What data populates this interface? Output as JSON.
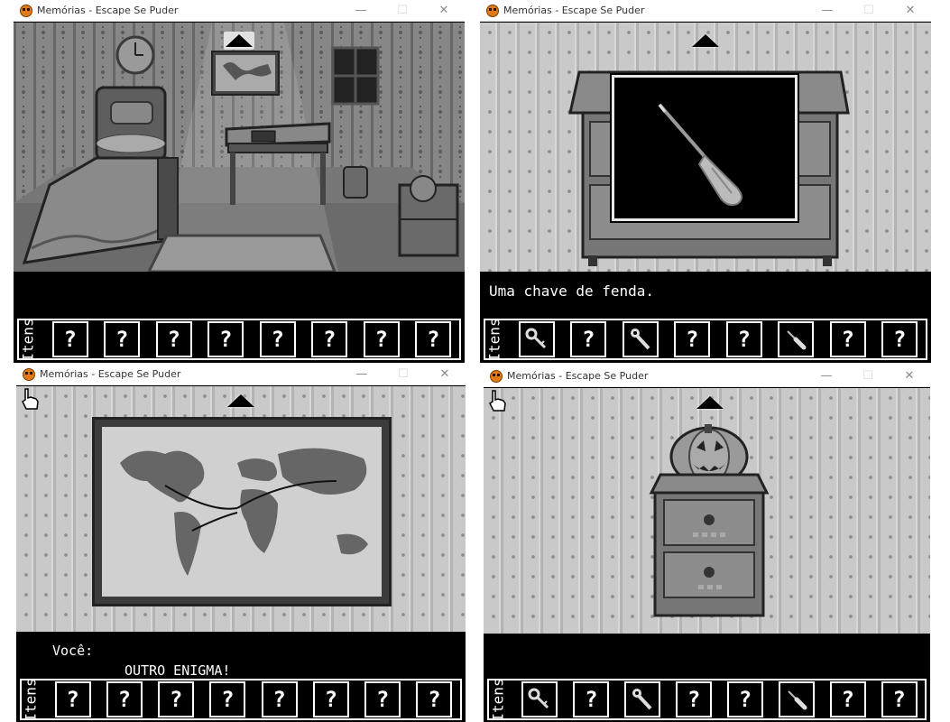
{
  "window_title": "Memórias - Escape Se Puder",
  "window_controls": {
    "minimize": "—",
    "maximize": "☐",
    "close": "✕"
  },
  "inventory_label": "Itens",
  "empty_slot": "?",
  "panel_tr": {
    "dialog_text": "Uma chave de fenda."
  },
  "panel_bl": {
    "speaker": "Você:",
    "dialog_text": "OUTRO ENIGMA!"
  },
  "icons": {
    "nav_up": "up-arrow-icon",
    "key": "key-icon",
    "wrench": "wrench-icon",
    "screwdriver": "screwdriver-icon",
    "cursor": "hand-cursor-icon"
  },
  "inventory_tl": [
    "?",
    "?",
    "?",
    "?",
    "?",
    "?",
    "?",
    "?"
  ],
  "inventory_tr": [
    "key",
    "?",
    "wrench",
    "?",
    "?",
    "screwdriver",
    "?",
    "?"
  ],
  "inventory_bl": [
    "?",
    "?",
    "?",
    "?",
    "?",
    "?",
    "?",
    "?"
  ],
  "inventory_br": [
    "key",
    "?",
    "wrench",
    "?",
    "?",
    "screwdriver",
    "?",
    "?"
  ],
  "colors": {
    "scene_bg": "#c9c9c9",
    "ui_black": "#000000",
    "ui_white": "#ffffff",
    "icon_orange": "#e07b16"
  }
}
